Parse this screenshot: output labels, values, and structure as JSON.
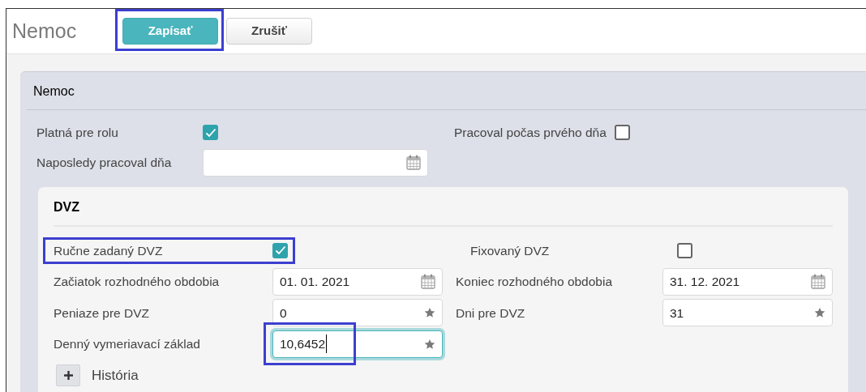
{
  "page": {
    "title": "Nemoc"
  },
  "toolbar": {
    "buttons": [
      {
        "label": "Zapísať",
        "kind": "primary",
        "highlighted": true
      },
      {
        "label": "Zrušiť",
        "kind": "secondary",
        "highlighted": false
      }
    ]
  },
  "panel": {
    "title": "Nemoc",
    "rows": [
      [
        {
          "label": "Platná pre rolu",
          "kind": "checkbox",
          "checked": true
        },
        {
          "label": "Pracoval počas prvého dňa",
          "kind": "checkbox",
          "checked": false
        }
      ],
      [
        {
          "label": "Naposledy pracoval dňa",
          "kind": "date"
        }
      ]
    ]
  },
  "section": {
    "title": "DVZ",
    "rows": [
      [
        {
          "label": "Ručne zadaný DVZ",
          "kind": "checkbox",
          "checked": true,
          "highlighted": true
        },
        {
          "label": "Fixovaný DVZ",
          "kind": "checkbox",
          "checked": false
        }
      ],
      [
        {
          "label": "Začiatok rozhodného obdobia",
          "kind": "date",
          "value": "01. 01. 2021"
        },
        {
          "label": "Koniec rozhodného obdobia",
          "kind": "date",
          "value": "31. 12. 2021"
        }
      ],
      [
        {
          "label": "Peniaze pre DVZ",
          "kind": "number",
          "value": "0"
        },
        {
          "label": "Dni pre DVZ",
          "kind": "number",
          "value": "31"
        }
      ],
      [
        {
          "label": "Denný vymeriavací základ",
          "kind": "number",
          "value": "10,6452",
          "focused": true,
          "highlighted": true
        }
      ]
    ],
    "history": {
      "label": "História",
      "expanded": false
    }
  }
}
